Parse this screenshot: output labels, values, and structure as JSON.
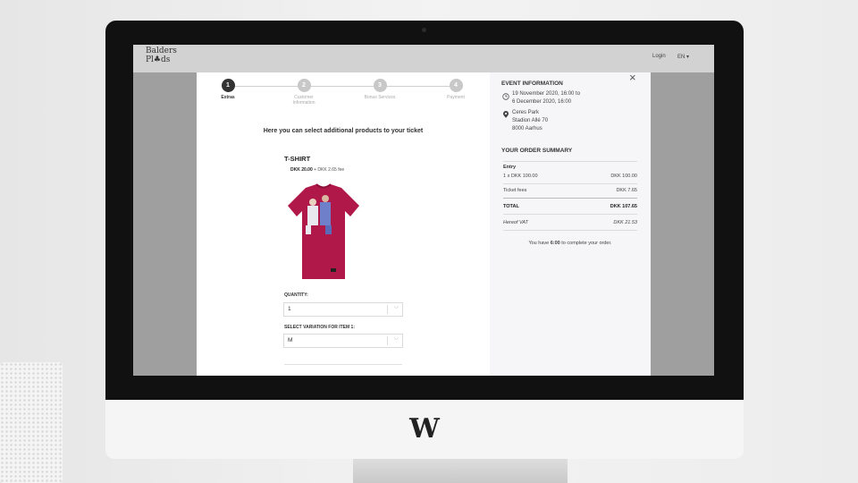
{
  "brand": {
    "line1": "Balders",
    "line2": "Pl♣ds"
  },
  "topbar": {
    "login": "Login",
    "lang": "EN ▾"
  },
  "steps": [
    {
      "num": "1",
      "label": "Extras",
      "active": true
    },
    {
      "num": "2",
      "label": "Customer Information",
      "active": false
    },
    {
      "num": "3",
      "label": "Bonus Services",
      "active": false
    },
    {
      "num": "4",
      "label": "Payment",
      "active": false
    }
  ],
  "main": {
    "intro": "Here you can select additional products to your ticket",
    "product_title": "T-SHIRT",
    "price_main": "DKK 20.00",
    "price_fee": "+ DKK 2.65 fee",
    "quantity_label": "QUANTITY:",
    "quantity_value": "1",
    "variation_label": "SELECT VARIATION FOR ITEM 1:",
    "variation_value": "M"
  },
  "event": {
    "heading": "EVENT INFORMATION",
    "date_line1": "19 November 2020, 16:00 to",
    "date_line2": "6 December 2020, 16:00",
    "venue": "Ceres Park",
    "street": "Stadion Allé 70",
    "city": "8000 Aarhus"
  },
  "summary": {
    "heading": "YOUR ORDER SUMMARY",
    "entry_label": "Entry",
    "entry_line": "1 x DKK 100.00",
    "entry_amount": "DKK 100.00",
    "fees_label": "Ticket fees",
    "fees_amount": "DKK 7.65",
    "total_label": "TOTAL",
    "total_amount": "DKK 107.65",
    "vat_label": "Hereof  VAT",
    "vat_amount": "DKK 21.53",
    "timer_pre": "You have",
    "timer_value": "6:00",
    "timer_post": "to complete your order."
  },
  "icons": {
    "close": "×",
    "chevron": "⌵"
  },
  "colors": {
    "shirt": "#b0184a",
    "active_step": "#333333"
  }
}
